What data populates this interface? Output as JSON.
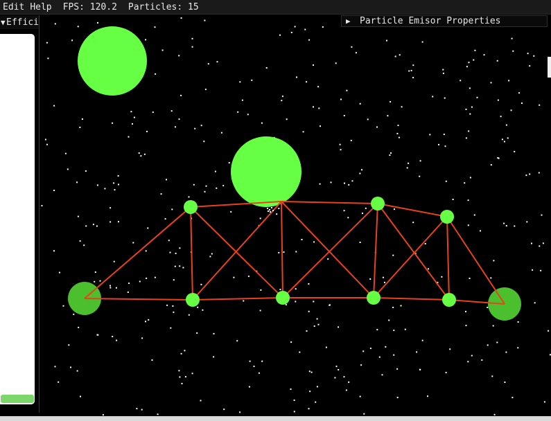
{
  "menu": {
    "edit_label": "Edit",
    "help_label": "Help",
    "fps_text": "FPS: 120.2",
    "particles_text": "Particles: 15"
  },
  "left_panel": {
    "title": "Effici",
    "collapse_icon": "triangle-down-icon"
  },
  "right_panel": {
    "title": "Particle Emisor Properties",
    "expand_icon": "triangle-right-icon"
  },
  "colors": {
    "background": "#000000",
    "star": "#ffffff",
    "node_bright": "#66ff44",
    "node_dark": "#4cbf2e",
    "link": "#e8421a",
    "panel_graph_bar": "#7dd66a"
  }
}
